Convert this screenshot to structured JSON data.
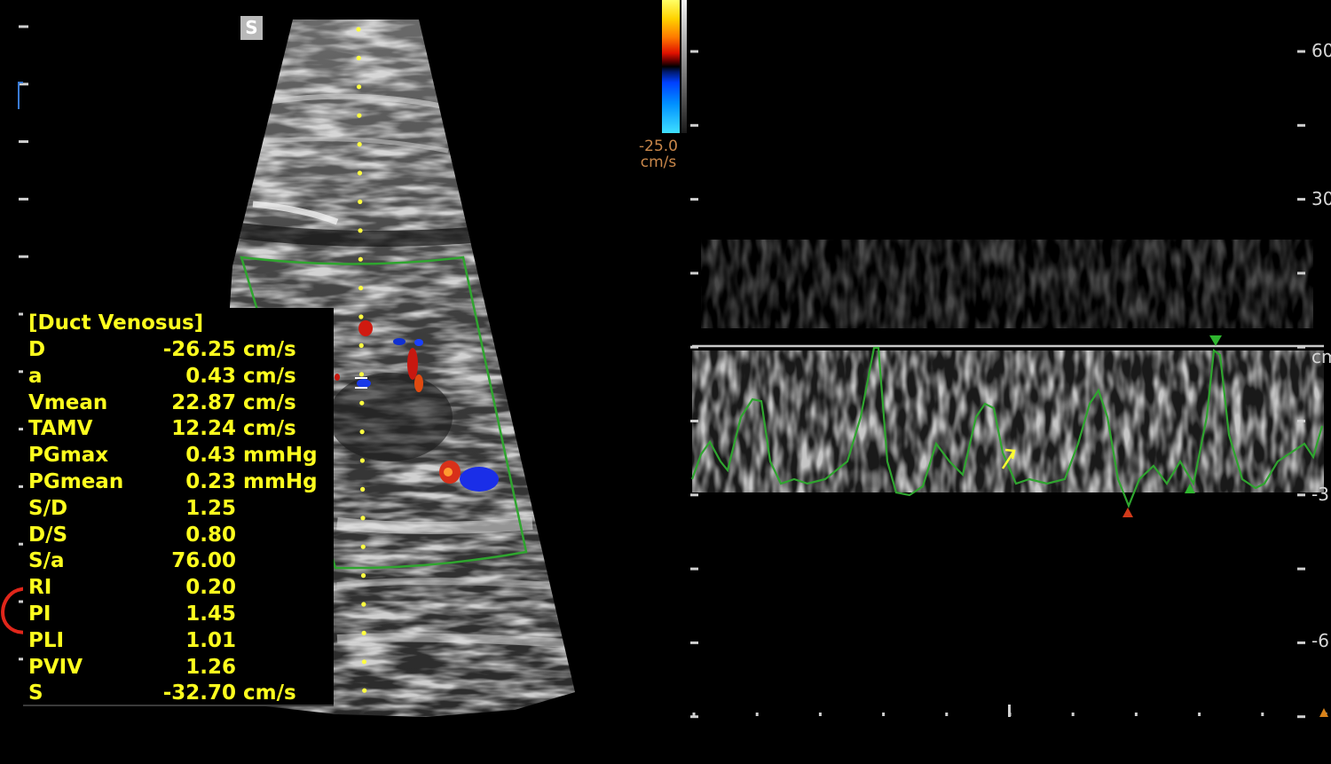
{
  "sector_marker": "S",
  "color_scale": {
    "value": "-25.0",
    "unit": "cm/s"
  },
  "measurements": {
    "title": "[Duct Venosus]",
    "rows": [
      {
        "label": "D",
        "value": "-26.25",
        "unit": "cm/s"
      },
      {
        "label": "a",
        "value": "0.43",
        "unit": "cm/s"
      },
      {
        "label": "Vmean",
        "value": "22.87",
        "unit": "cm/s"
      },
      {
        "label": "TAMV",
        "value": "12.24",
        "unit": "cm/s"
      },
      {
        "label": "PGmax",
        "value": "0.43",
        "unit": "mmHg"
      },
      {
        "label": "PGmean",
        "value": "0.23",
        "unit": "mmHg"
      },
      {
        "label": "S/D",
        "value": "1.25",
        "unit": ""
      },
      {
        "label": "D/S",
        "value": "0.80",
        "unit": ""
      },
      {
        "label": "S/a",
        "value": "76.00",
        "unit": ""
      },
      {
        "label": "RI",
        "value": "0.20",
        "unit": ""
      },
      {
        "label": "PI",
        "value": "1.45",
        "unit": ""
      },
      {
        "label": "PLI",
        "value": "1.01",
        "unit": ""
      },
      {
        "label": "PVIV",
        "value": "1.26",
        "unit": ""
      },
      {
        "label": "S",
        "value": "-32.70",
        "unit": "cm/s"
      }
    ],
    "highlighted_rows": [
      "RI",
      "PI"
    ]
  },
  "velocity_scale": {
    "labels": [
      "60",
      "30",
      "cm",
      "-3",
      "-6"
    ],
    "unit_label": "cm"
  },
  "colors": {
    "measurement_text": "#ffff1e",
    "roi_box": "#2fa52f",
    "doppler_trace": "#2fa52f",
    "highlight_circle": "#e0261a",
    "color_scale_label": "#c9874a",
    "marker_red": "#d23a1a",
    "marker_green": "#2fb52f"
  },
  "icons": [
    "sector-marker-icon",
    "cursor-arrow-icon",
    "sample-volume-icon"
  ]
}
